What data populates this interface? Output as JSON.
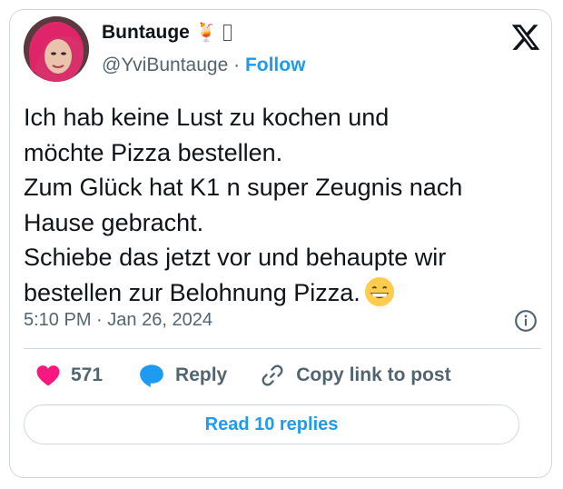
{
  "author": {
    "name": "Buntauge",
    "handle": "@YviBuntauge",
    "name_emoji": "🍹",
    "separator": "·",
    "follow_label": "Follow"
  },
  "icons": {
    "logo": "x-logo-icon",
    "avatar": "profile-photo",
    "info": "info-icon",
    "like": "heart-icon",
    "reply": "reply-bubble-icon",
    "copy": "link-icon",
    "inline_emoji": "grinning-face-emoji"
  },
  "tweet": {
    "text": "Ich hab keine Lust zu kochen und\nmöchte Pizza bestellen.\nZum Glück hat K1 n super Zeugnis nach\nHause gebracht.\nSchiebe das jetzt vor und behaupte wir\nbestellen zur Belohnung Pizza.",
    "time": "5:10 PM",
    "separator": "·",
    "date": "Jan 26, 2024"
  },
  "actions": {
    "likes": "571",
    "reply_label": "Reply",
    "copy_label": "Copy link to post"
  },
  "read_replies_label": "Read 10 replies",
  "colors": {
    "accent": "#1d9bf0",
    "like": "#f91880",
    "text": "#0f1419",
    "secondary": "#536471",
    "border": "#cfd9de"
  }
}
